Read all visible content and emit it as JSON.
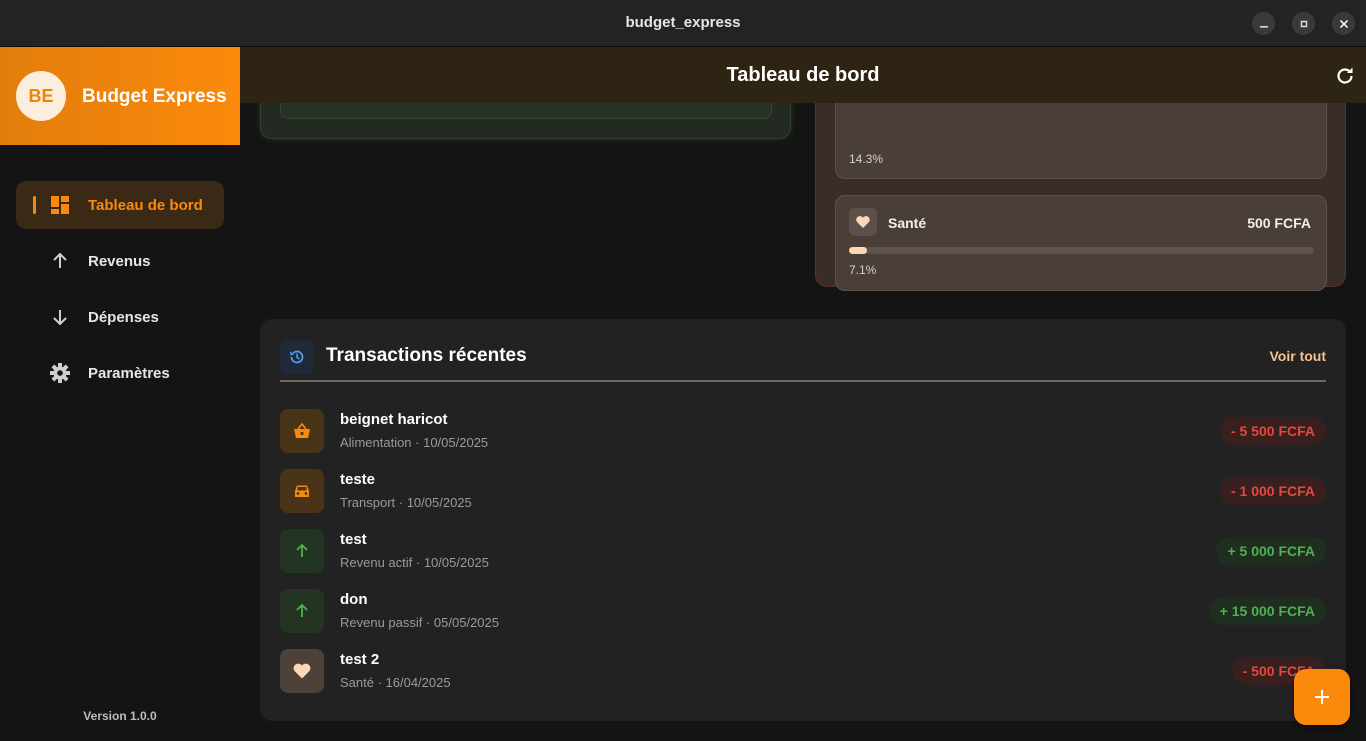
{
  "window": {
    "title": "budget_express"
  },
  "brand": {
    "logo_text": "BE",
    "name": "Budget Express"
  },
  "sidebar": {
    "items": [
      {
        "label": "Tableau de bord",
        "icon": "dashboard-icon",
        "active": true
      },
      {
        "label": "Revenus",
        "icon": "arrow-up-icon"
      },
      {
        "label": "Dépenses",
        "icon": "arrow-down-icon"
      },
      {
        "label": "Paramètres",
        "icon": "gear-icon"
      }
    ],
    "version": "Version 1.0.0"
  },
  "header": {
    "title": "Tableau de bord"
  },
  "categories": [
    {
      "percent": "14.3%"
    },
    {
      "name": "Santé",
      "amount": "500 FCFA",
      "percent": "7.1%",
      "fraction": 0.071,
      "icon": "heart-icon"
    }
  ],
  "transactions": {
    "title": "Transactions récentes",
    "see_all": "Voir tout",
    "items": [
      {
        "name": "beignet haricot",
        "sub": "Alimentation · 10/05/2025",
        "amount": "- 5 500 FCFA",
        "icon": "basket-icon"
      },
      {
        "name": "teste",
        "sub": "Transport · 10/05/2025",
        "amount": "- 1 000 FCFA",
        "icon": "car-icon"
      },
      {
        "name": "test",
        "sub": "Revenu actif · 10/05/2025",
        "amount": "+ 5 000 FCFA",
        "icon": "arrow-up-icon"
      },
      {
        "name": "don",
        "sub": "Revenu passif · 05/05/2025",
        "amount": "+ 15 000 FCFA",
        "icon": "arrow-up-icon"
      },
      {
        "name": "test 2",
        "sub": "Santé · 16/04/2025",
        "amount": "- 500 FCFA",
        "icon": "heart-icon"
      }
    ]
  },
  "colors": {
    "accent": "#fb8a0c",
    "negative": "#e5483f",
    "positive": "#4fb14f"
  }
}
